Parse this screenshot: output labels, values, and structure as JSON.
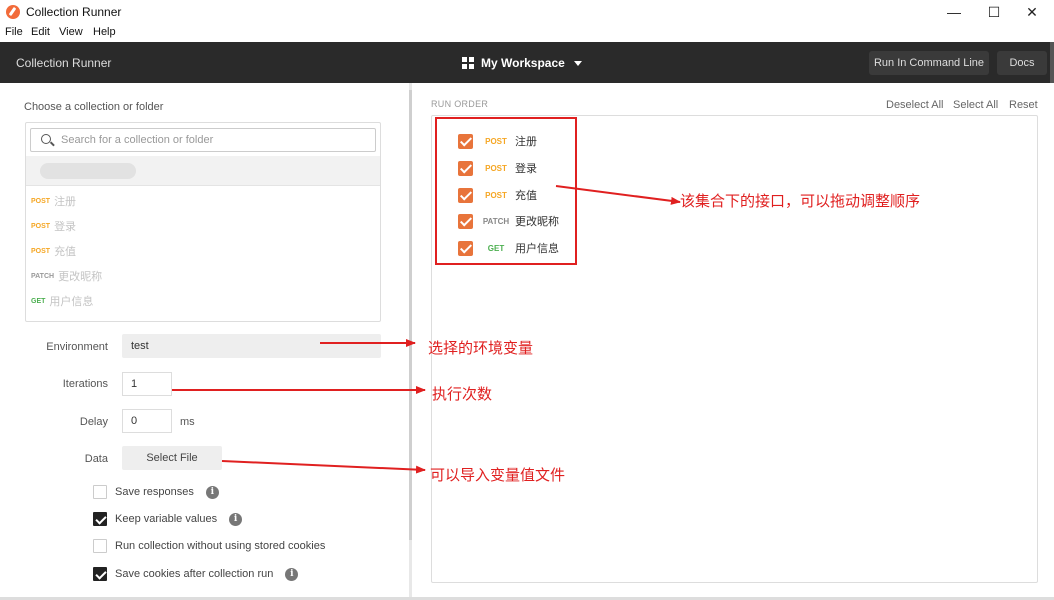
{
  "window": {
    "title": "Collection Runner",
    "minimize": "—",
    "maximize": "☐",
    "close": "✕"
  },
  "menu": [
    "File",
    "Edit",
    "View",
    "Help"
  ],
  "header": {
    "app_title": "Collection Runner",
    "workspace": "My Workspace",
    "run_command_line": "Run In Command Line",
    "docs": "Docs"
  },
  "left": {
    "choose_label": "Choose a collection or folder",
    "search_placeholder": "Search for a collection or folder",
    "requests": [
      {
        "method": "POST",
        "name": "注册"
      },
      {
        "method": "POST",
        "name": "登录"
      },
      {
        "method": "POST",
        "name": "充值"
      },
      {
        "method": "PATCH",
        "name": "更改昵称"
      },
      {
        "method": "GET",
        "name": "用户信息"
      }
    ],
    "environment_label": "Environment",
    "environment_value": "test",
    "iterations_label": "Iterations",
    "iterations_value": "1",
    "delay_label": "Delay",
    "delay_value": "0",
    "delay_unit": "ms",
    "data_label": "Data",
    "select_file": "Select File",
    "options": [
      {
        "label": "Save responses",
        "checked": false,
        "info": true
      },
      {
        "label": "Keep variable values",
        "checked": true,
        "info": true
      },
      {
        "label": "Run collection without using stored cookies",
        "checked": false,
        "info": false
      },
      {
        "label": "Save cookies after collection run",
        "checked": true,
        "info": true
      }
    ]
  },
  "right": {
    "run_order": "RUN ORDER",
    "deselect_all": "Deselect All",
    "select_all": "Select All",
    "reset": "Reset",
    "requests": [
      {
        "method": "POST",
        "name": "注册"
      },
      {
        "method": "POST",
        "name": "登录"
      },
      {
        "method": "POST",
        "name": "充值"
      },
      {
        "method": "PATCH",
        "name": "更改昵称"
      },
      {
        "method": "GET",
        "name": "用户信息"
      }
    ]
  },
  "annotations": {
    "order": "该集合下的接口，可以拖动调整顺序",
    "env": "选择的环境变量",
    "iter": "执行次数",
    "data": "可以导入变量值文件"
  },
  "colors": {
    "POST": "#f5a623",
    "PATCH": "#888888",
    "GET": "#4caf50",
    "accent": "#e8743b",
    "annotation": "#e02020"
  }
}
